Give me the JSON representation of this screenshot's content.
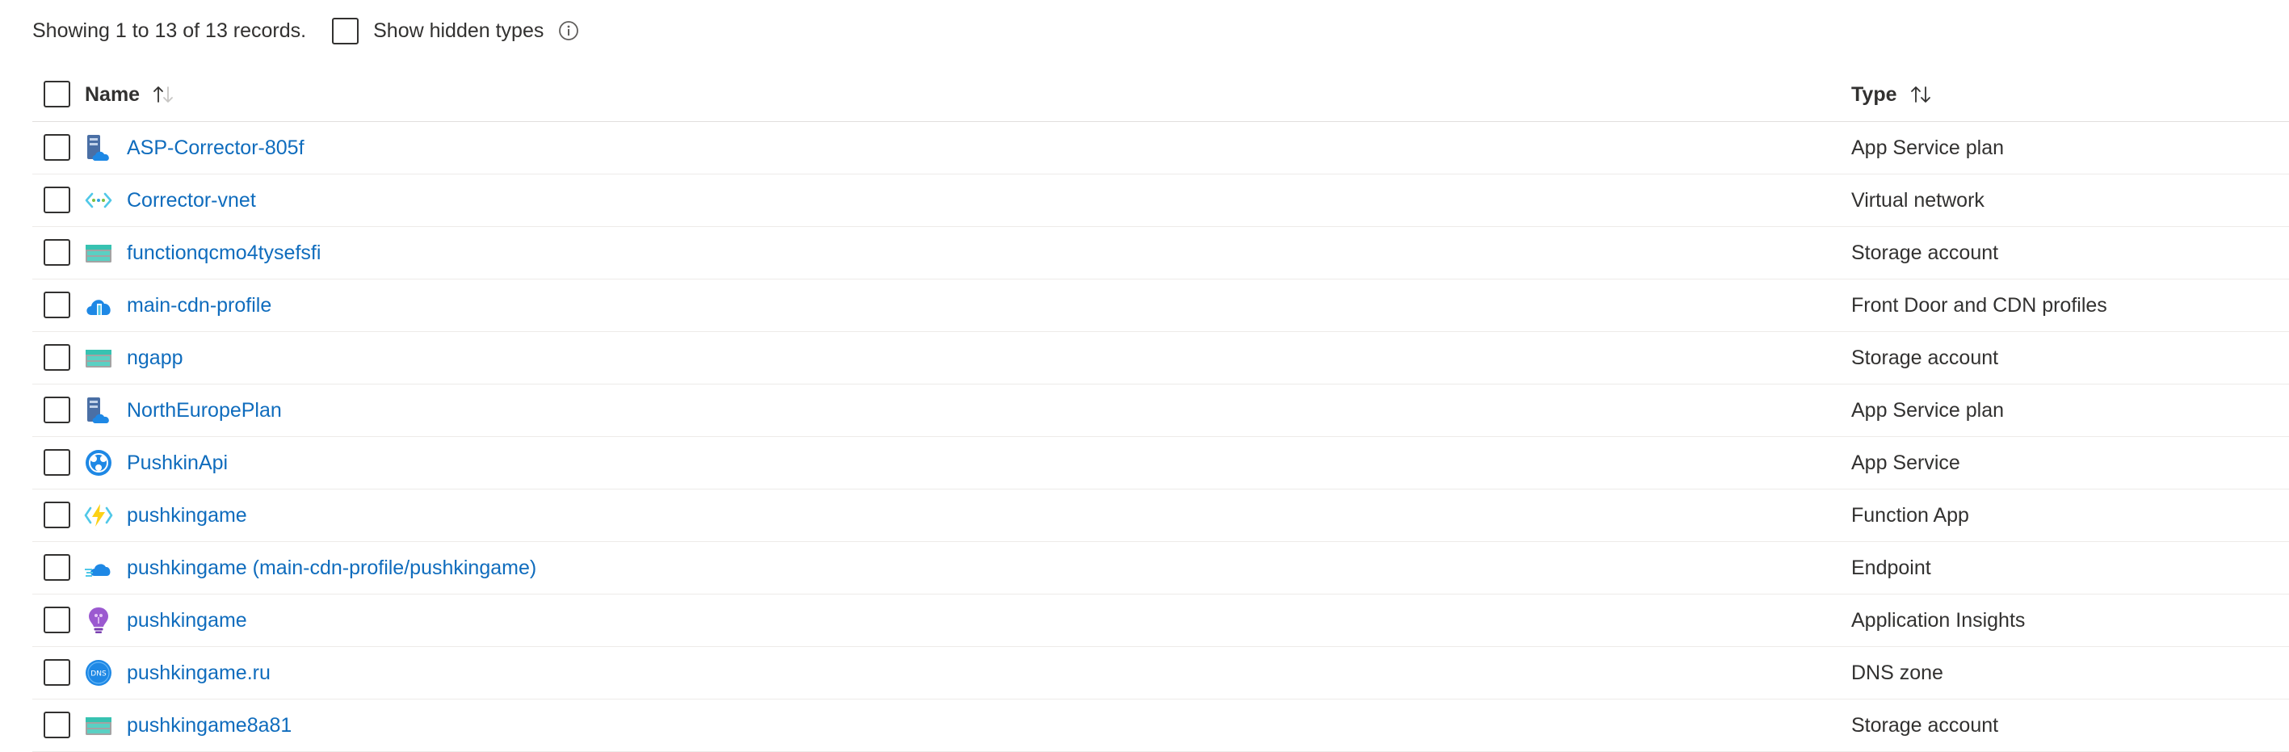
{
  "toolbar": {
    "records_text": "Showing 1 to 13 of 13 records.",
    "show_hidden_label": "Show hidden types",
    "info_icon": "info-icon"
  },
  "columns": {
    "name": "Name",
    "type": "Type"
  },
  "rows": [
    {
      "name": "ASP-Corrector-805f",
      "type": "App Service plan",
      "icon": "app-service-plan-icon"
    },
    {
      "name": "Corrector-vnet",
      "type": "Virtual network",
      "icon": "virtual-network-icon"
    },
    {
      "name": "functionqcmo4tysefsfi",
      "type": "Storage account",
      "icon": "storage-account-icon"
    },
    {
      "name": "main-cdn-profile",
      "type": "Front Door and CDN profiles",
      "icon": "front-door-cdn-icon"
    },
    {
      "name": "ngapp",
      "type": "Storage account",
      "icon": "storage-account-icon"
    },
    {
      "name": "NorthEuropePlan",
      "type": "App Service plan",
      "icon": "app-service-plan-icon"
    },
    {
      "name": "PushkinApi",
      "type": "App Service",
      "icon": "app-service-icon"
    },
    {
      "name": "pushkingame",
      "type": "Function App",
      "icon": "function-app-icon"
    },
    {
      "name": "pushkingame (main-cdn-profile/pushkingame)",
      "type": "Endpoint",
      "icon": "cdn-endpoint-icon"
    },
    {
      "name": "pushkingame",
      "type": "Application Insights",
      "icon": "application-insights-icon"
    },
    {
      "name": "pushkingame.ru",
      "type": "DNS zone",
      "icon": "dns-zone-icon"
    },
    {
      "name": "pushkingame8a81",
      "type": "Storage account",
      "icon": "storage-account-icon"
    }
  ],
  "colors": {
    "link": "#0f6cbd",
    "text": "#323130",
    "divider": "#edebe9"
  }
}
